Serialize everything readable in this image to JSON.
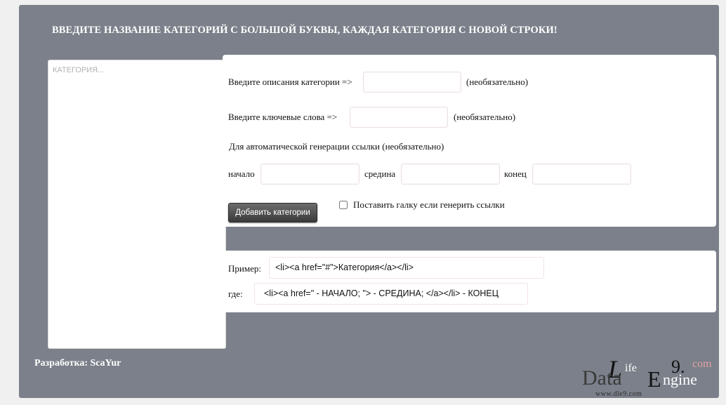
{
  "heading": "ВВЕДИТЕ НАЗВАНИЕ КАТЕГОРИЙ С БОЛЬШОЙ БУКВЫ, КАЖДАЯ КАТЕГОРИЯ С НОВОЙ СТРОКИ!",
  "categories": {
    "placeholder": "КАТЕГОРИЯ...",
    "value": ""
  },
  "form": {
    "description_label": "Введите описания категории =>",
    "description_value": "",
    "optional": "(необязательно)",
    "keywords_label": "Введите ключевые слова =>",
    "keywords_value": "",
    "autogen_label": "Для автоматической генерации ссылки (необязательно)",
    "start_label": "начало",
    "middle_label": "средина",
    "end_label": "конец",
    "start_value": "",
    "middle_value": "",
    "end_value": "",
    "add_button": "Добавить категории",
    "checkbox_label": "Поставить галку если генерить ссылки",
    "checkbox_checked": false
  },
  "example": {
    "example_label": "Пример:",
    "example_code": "<li><a href=\"#\">Категория</a></li>",
    "where_label": "где:",
    "where_code": "<li><a href=\" - НАЧАЛО; \"> - СРЕДИНА;  </a></li> - КОНЕЦ"
  },
  "footer": "Разработка: ScaYur",
  "logo": {
    "l": "L",
    "ife": "ife",
    "nine": "9.",
    "com": "com",
    "data": "Data",
    "e": "E",
    "ngine": "ngine",
    "url": "www.dle9.com"
  },
  "colors": {
    "panel": "#7b808a",
    "button_top": "#6c6c6c",
    "button_bottom": "#3a3a3a",
    "logo_com": "#e0a0a0"
  }
}
